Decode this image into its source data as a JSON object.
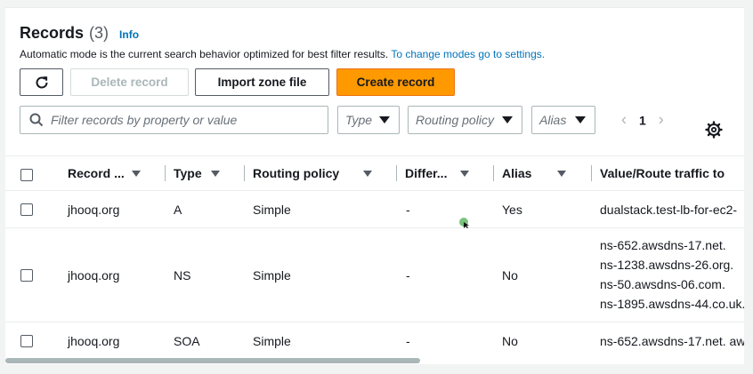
{
  "header": {
    "title": "Records",
    "count": "(3)",
    "info": "Info",
    "description": "Automatic mode is the current search behavior optimized for best filter results.",
    "description_link": "To change modes go to settings."
  },
  "toolbar": {
    "refresh_icon": "refresh-icon",
    "delete_label": "Delete record",
    "import_label": "Import zone file",
    "create_label": "Create record",
    "accent_color": "#ff9900"
  },
  "filters": {
    "search_placeholder": "Filter records by property or value",
    "type_label": "Type",
    "routing_label": "Routing policy",
    "alias_label": "Alias"
  },
  "pagination": {
    "prev": "‹",
    "current_page": "1",
    "next": "›"
  },
  "table": {
    "columns": {
      "record": "Record ...",
      "type": "Type",
      "routing": "Routing policy",
      "differ": "Differ...",
      "alias": "Alias",
      "value": "Value/Route traffic to"
    },
    "rows": [
      {
        "name": "jhooq.org",
        "type": "A",
        "routing": "Simple",
        "differ": "-",
        "alias": "Yes",
        "values": [
          "dualstack.test-lb-for-ec2-"
        ]
      },
      {
        "name": "jhooq.org",
        "type": "NS",
        "routing": "Simple",
        "differ": "-",
        "alias": "No",
        "values": [
          "ns-652.awsdns-17.net.",
          "ns-1238.awsdns-26.org.",
          "ns-50.awsdns-06.com.",
          "ns-1895.awsdns-44.co.uk."
        ]
      },
      {
        "name": "jhooq.org",
        "type": "SOA",
        "routing": "Simple",
        "differ": "-",
        "alias": "No",
        "values": [
          "ns-652.awsdns-17.net. aw"
        ]
      }
    ]
  }
}
